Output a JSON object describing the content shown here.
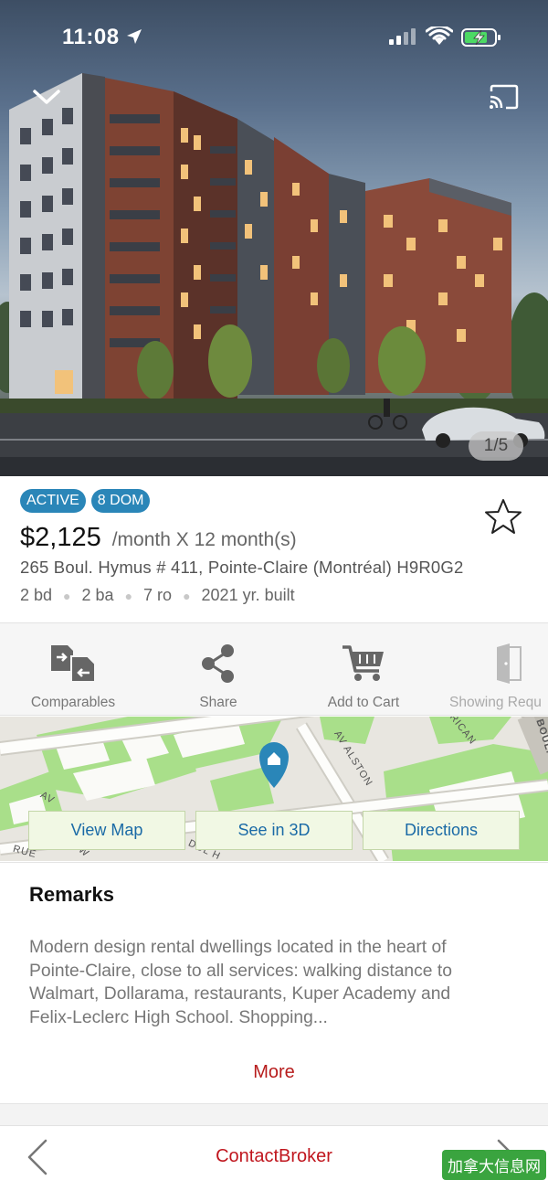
{
  "status_bar": {
    "time": "11:08"
  },
  "hero": {
    "photo_counter": "1/5"
  },
  "listing": {
    "badges": [
      "ACTIVE",
      "8 DOM"
    ],
    "price": "$2,125",
    "period": "/month X 12 month(s)",
    "address": "265 Boul. Hymus # 411, Pointe-Claire (Montréal)  H9R0G2",
    "specs": [
      "2 bd",
      "2 ba",
      "7 ro",
      "2021 yr. built"
    ]
  },
  "actions": [
    {
      "label": "Comparables",
      "icon": "comparables-icon"
    },
    {
      "label": "Share",
      "icon": "share-icon"
    },
    {
      "label": "Add to Cart",
      "icon": "cart-icon"
    },
    {
      "label": "Showing Requ",
      "icon": "door-icon"
    }
  ],
  "map": {
    "street_labels": [
      "AV ALSTON",
      "BOUL. H",
      "RICAN",
      "AV",
      "RUE",
      "DUL H",
      "W"
    ],
    "buttons": [
      "View Map",
      "See in 3D",
      "Directions"
    ]
  },
  "remarks": {
    "title": "Remarks",
    "lines": [
      "Modern design rental dwellings located in the heart of",
      "Pointe-Claire, close to all services: walking distance to",
      "Walmart, Dollarama, restaurants, Kuper Academy and",
      "Felix-Leclerc High School. Shopping..."
    ],
    "more_label": "More"
  },
  "bottom_nav": {
    "contact_label": "ContactBroker"
  },
  "watermark": "加拿大信息网",
  "colors": {
    "badge": "#2a86b8",
    "accent_red": "#c0161e",
    "map_button_text": "#1a6aa6",
    "map_pin": "#2a86b8"
  }
}
